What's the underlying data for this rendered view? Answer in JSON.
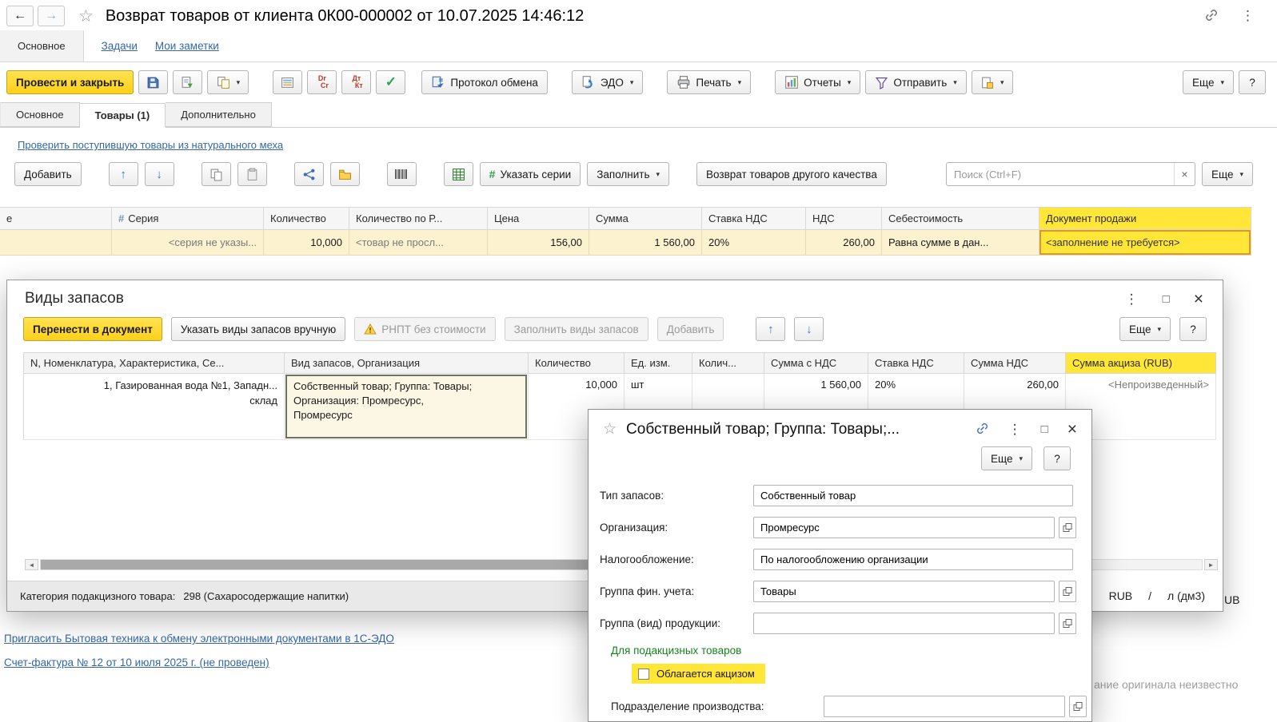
{
  "icons": {
    "back": "←",
    "forward": "→",
    "star": "☆",
    "dots": "⋮",
    "caret": "▾",
    "check": "✓",
    "up": "↑",
    "down": "↓",
    "close": "×",
    "maximize": "□",
    "hash": "#",
    "dr": "Dr",
    "cr": "Cr",
    "dt": "Дт",
    "kt": "Кт",
    "scroll_left": "◄",
    "scroll_right": "►",
    "clear": "×"
  },
  "titlebar": {
    "title": "Возврат товаров от клиента 0К00-000002 от 10.07.2025 14:46:12"
  },
  "nav": {
    "main": "Основное",
    "tasks": "Задачи",
    "notes": "Мои заметки"
  },
  "toolbar": {
    "post_and_close": "Провести и закрыть",
    "protocol": "Протокол обмена",
    "edo": "ЭДО",
    "print": "Печать",
    "reports": "Отчеты",
    "send": "Отправить",
    "more": "Еще",
    "help": "?"
  },
  "doc_tabs": {
    "main": "Основное",
    "goods": "Товары (1)",
    "extra": "Дополнительно"
  },
  "links": {
    "fur_check": "Проверить поступившую товары из натурального меха"
  },
  "goods_toolbar": {
    "add": "Добавить",
    "specify_series": "Указать серии",
    "fill": "Заполнить",
    "return_other_quality": "Возврат товаров другого качества",
    "search_placeholder": "Поиск (Ctrl+F)",
    "more": "Еще"
  },
  "goods_table": {
    "headers": [
      "е",
      "Серия",
      "Количество",
      "Количество по Р...",
      "Цена",
      "Сумма",
      "Ставка НДС",
      "НДС",
      "Себестоимость",
      "Документ продажи"
    ],
    "row": {
      "series": "<серия не указы...",
      "qty": "10,000",
      "qty_reg": "<товар не просл...",
      "price": "156,00",
      "amount": "1 560,00",
      "vat_rate": "20%",
      "vat_amount": "260,00",
      "cost": "Равна сумме в дан...",
      "sales_doc": "<заполнение не требуется>"
    }
  },
  "inventory_dialog": {
    "title": "Виды запасов",
    "toolbar": {
      "transfer": "Перенести в документ",
      "manual": "Указать виды запасов вручную",
      "rnpt": "РНПТ без стоимости",
      "fill": "Заполнить виды запасов",
      "add": "Добавить",
      "more": "Еще",
      "help": "?"
    },
    "headers": [
      "N, Номенклатура, Характеристика, Се...",
      "Вид запасов, Организация",
      "Количество",
      "Ед. изм.",
      "Колич...",
      "Сумма с НДС",
      "Ставка НДС",
      "Сумма НДС",
      "Сумма акциза (RUB)"
    ],
    "row": {
      "nomenclature": "1, Газированная вода №1, Западн...\nсклад",
      "kind": "Собственный товар; Группа: Товары;\nОрганизация: Промресурс,\nПромресурс",
      "qty": "10,000",
      "unit": "шт",
      "amount_with_vat": "1 560,00",
      "vat_rate": "20%",
      "vat_amount": "260,00",
      "excise": "<Непроизведенный>"
    },
    "footer": {
      "category_label": "Категория подакцизного товара:",
      "category_value": "298 (Сахаросодержащие напитки)",
      "currency": "RUB",
      "divider": "/",
      "unit": "л (дм3)"
    }
  },
  "kind_dialog": {
    "title": "Собственный товар; Группа: Товары;...",
    "more": "Еще",
    "help": "?",
    "fields": [
      {
        "label": "Тип запасов:",
        "value": "Собственный товар"
      },
      {
        "label": "Организация:",
        "value": "Промресурс"
      },
      {
        "label": "Налогообложение:",
        "value": "По налогообложению организации"
      },
      {
        "label": "Группа фин. учета:",
        "value": "Товары"
      },
      {
        "label": "Группа (вид) продукции:",
        "value": ""
      }
    ],
    "excise_section": "Для подакцизных товаров",
    "excise_checkbox": "Облагается акцизом",
    "production_label": "Подразделение производства:",
    "production_value": ""
  },
  "footer": {
    "edo_invite_link": "Пригласить Бытовая техника  к обмену электронными документами в 1С-ЭДО",
    "invoice_link": "Счет-фактура № 12 от 10 июля 2025 г. (не проведен)",
    "original_status_fragment": "ание оригинала неизвестно",
    "currency_fragment": "UB"
  }
}
